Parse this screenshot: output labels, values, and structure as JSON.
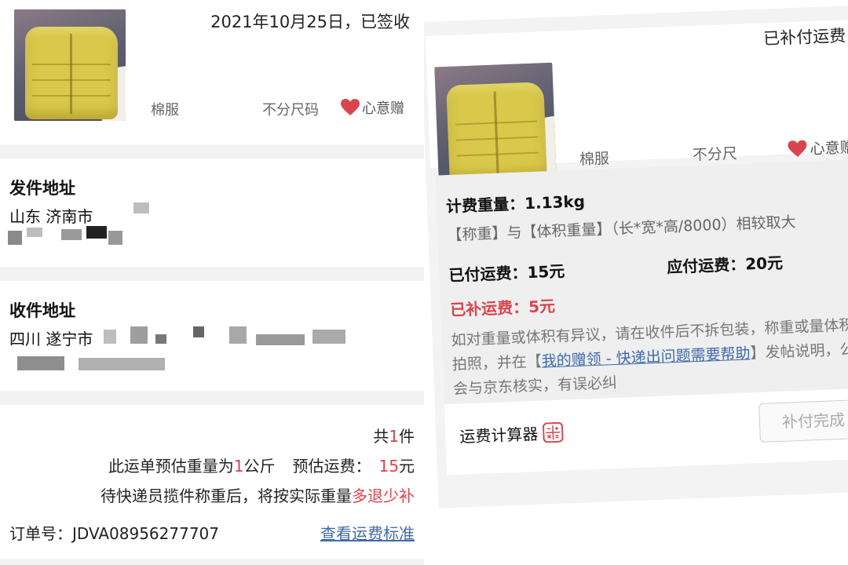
{
  "left": {
    "order": {
      "date_status": "2021年10月25日，已签收",
      "item_name": "棉服",
      "item_size": "不分尺码",
      "gift_label": "心意赠"
    },
    "sender": {
      "title": "发件地址",
      "city": "山东 济南市"
    },
    "receiver": {
      "title": "收件地址",
      "city": "四川 遂宁市"
    },
    "summary": {
      "count_prefix": "共",
      "count_value": "1",
      "count_suffix": "件",
      "weight_prefix": "此运单预估重量为",
      "weight_value": "1",
      "weight_suffix": "公斤",
      "fee_label": "预估运费：",
      "fee_value": "15",
      "fee_unit": "元",
      "rule_text": "待快递员揽件称重后，将按实际重量",
      "rule_highlight": "多退少补",
      "order_no": "订单号：JDVA08956277707",
      "std_link": "查看运费标准"
    }
  },
  "right": {
    "status": "已补付运费",
    "item_name": "棉服",
    "item_size": "不分尺",
    "gift_label": "心意赠",
    "billing_weight": "计费重量：1.13kg",
    "formula": "【称重】与【体积重量】（长*宽*高/8000）相较取大",
    "paid_fee": "已付运费：15元",
    "due_fee": "应付运费：20元",
    "extra_fee": "已补运费：5元",
    "note_before": "如对重量或体积有异议，请在收件后不拆包装，称重或量体积、拍照，并在【",
    "note_link": "我的赠领 - 快递出问题需要帮助",
    "note_after": "】发帖说明，公社会与京东核实，有误必纠",
    "calculator_label": "运费计算器",
    "done_button": "补付完成"
  },
  "colors": {
    "accent_red": "#d8454f",
    "link_blue": "#3f6aa8",
    "jacket_yellow": "#d9c84a"
  },
  "icons": {
    "heart": "heart-icon",
    "calculator": "calculator-icon"
  }
}
